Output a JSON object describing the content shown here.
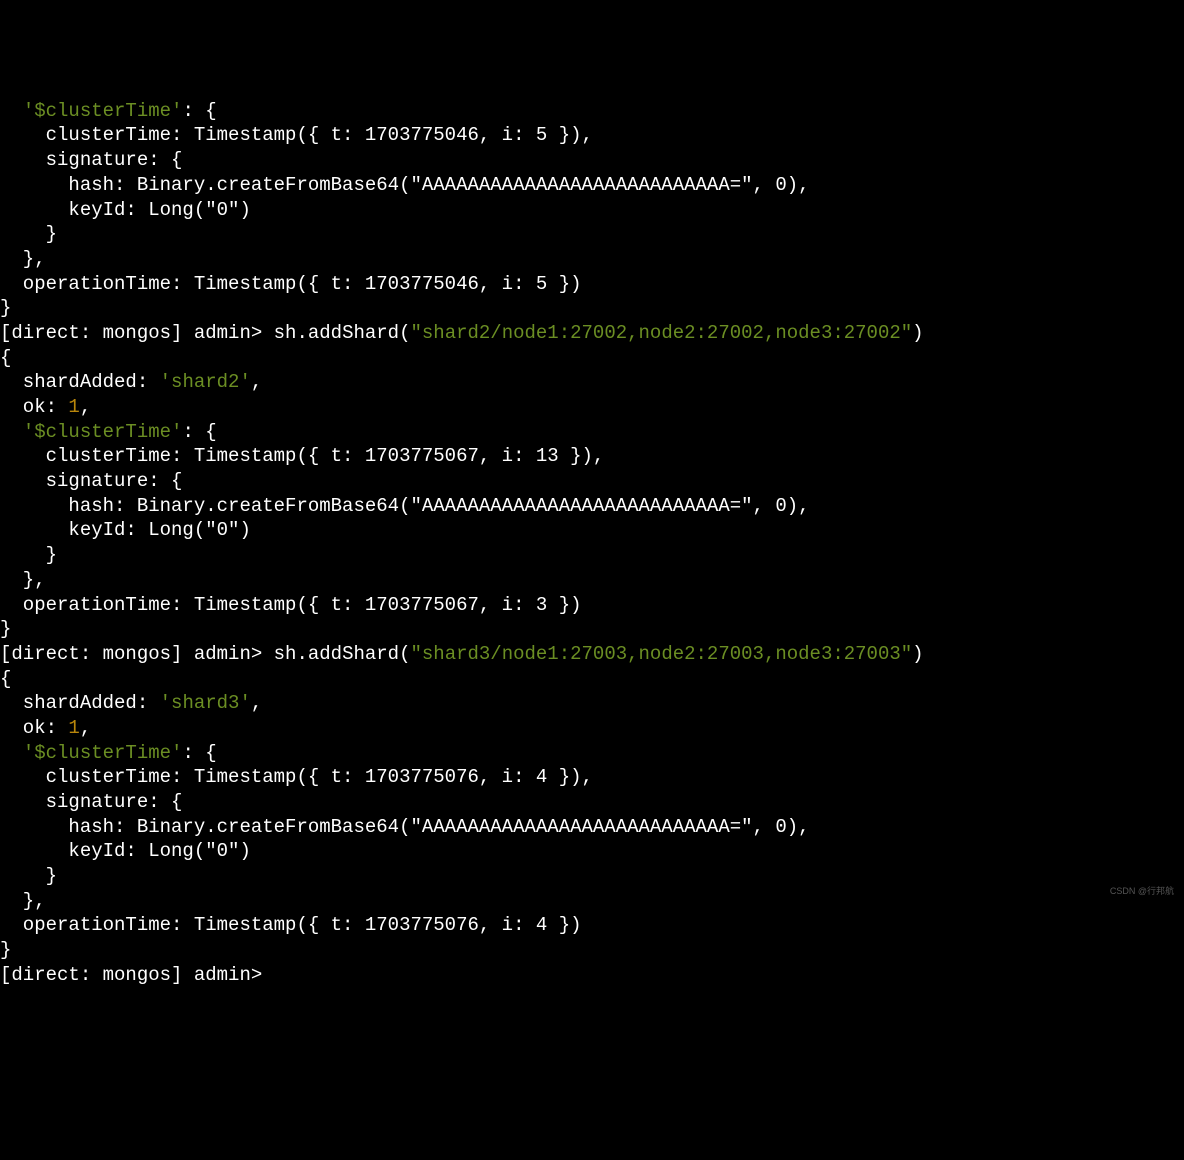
{
  "terminal": {
    "block1": {
      "line1_pre": "  ",
      "line1_key": "'$clusterTime'",
      "line1_post": ": {",
      "line2": "    clusterTime: Timestamp({ t: 1703775046, i: 5 }),",
      "line3": "    signature: {",
      "line4": "      hash: Binary.createFromBase64(\"AAAAAAAAAAAAAAAAAAAAAAAAAAA=\", 0),",
      "line5": "      keyId: Long(\"0\")",
      "line6": "    }",
      "line7": "  },",
      "line8": "  operationTime: Timestamp({ t: 1703775046, i: 5 })",
      "line9": "}"
    },
    "cmd2": {
      "prompt": "[direct: mongos] admin> ",
      "command_pre": "sh.addShard(",
      "command_arg": "\"shard2/node1:27002,node2:27002,node3:27002\"",
      "command_post": ")"
    },
    "block2": {
      "line1": "{",
      "line2_pre": "  shardAdded: ",
      "line2_val": "'shard2'",
      "line2_post": ",",
      "line3_pre": "  ok: ",
      "line3_val": "1",
      "line3_post": ",",
      "line4_pre": "  ",
      "line4_key": "'$clusterTime'",
      "line4_post": ": {",
      "line5": "    clusterTime: Timestamp({ t: 1703775067, i: 13 }),",
      "line6": "    signature: {",
      "line7": "      hash: Binary.createFromBase64(\"AAAAAAAAAAAAAAAAAAAAAAAAAAA=\", 0),",
      "line8": "      keyId: Long(\"0\")",
      "line9": "    }",
      "line10": "  },",
      "line11": "  operationTime: Timestamp({ t: 1703775067, i: 3 })",
      "line12": "}"
    },
    "cmd3": {
      "prompt": "[direct: mongos] admin> ",
      "command_pre": "sh.addShard(",
      "command_arg": "\"shard3/node1:27003,node2:27003,node3:27003\"",
      "command_post": ")"
    },
    "block3": {
      "line1": "{",
      "line2_pre": "  shardAdded: ",
      "line2_val": "'shard3'",
      "line2_post": ",",
      "line3_pre": "  ok: ",
      "line3_val": "1",
      "line3_post": ",",
      "line4_pre": "  ",
      "line4_key": "'$clusterTime'",
      "line4_post": ": {",
      "line5": "    clusterTime: Timestamp({ t: 1703775076, i: 4 }),",
      "line6": "    signature: {",
      "line7": "      hash: Binary.createFromBase64(\"AAAAAAAAAAAAAAAAAAAAAAAAAAA=\", 0),",
      "line8": "      keyId: Long(\"0\")",
      "line9": "    }",
      "line10": "  },",
      "line11": "  operationTime: Timestamp({ t: 1703775076, i: 4 })",
      "line12": "}"
    },
    "cmd4": {
      "prompt": "[direct: mongos] admin> "
    },
    "watermark": "CSDN @行邦航"
  }
}
